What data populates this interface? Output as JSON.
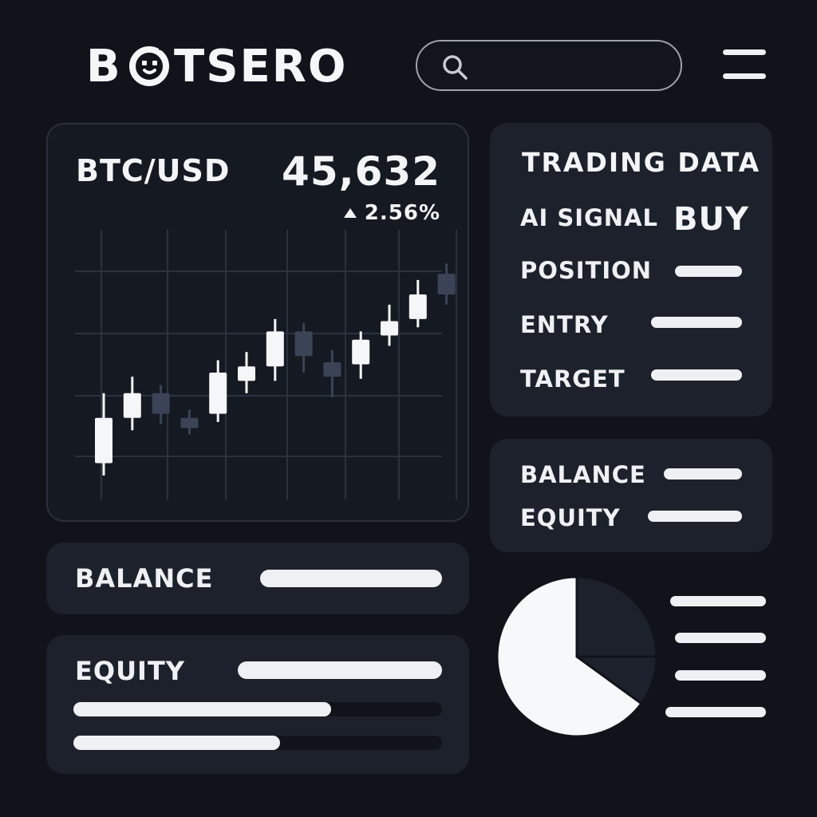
{
  "header": {
    "logo_text": "BOTSERO",
    "search": {
      "placeholder": ""
    }
  },
  "market": {
    "pair": "BTC/USD",
    "price": "45,632",
    "change": "2.56%",
    "change_direction": "up",
    "candles": [
      {
        "open": 0.28,
        "close": 0.5,
        "high": 0.62,
        "low": 0.22,
        "bullish": true
      },
      {
        "open": 0.5,
        "close": 0.62,
        "high": 0.7,
        "low": 0.44,
        "bullish": true
      },
      {
        "open": 0.62,
        "close": 0.52,
        "high": 0.66,
        "low": 0.47,
        "bullish": false
      },
      {
        "open": 0.5,
        "close": 0.45,
        "high": 0.54,
        "low": 0.42,
        "bullish": false
      },
      {
        "open": 0.52,
        "close": 0.72,
        "high": 0.78,
        "low": 0.48,
        "bullish": true
      },
      {
        "open": 0.68,
        "close": 0.75,
        "high": 0.82,
        "low": 0.62,
        "bullish": true
      },
      {
        "open": 0.75,
        "close": 0.92,
        "high": 0.98,
        "low": 0.68,
        "bullish": true
      },
      {
        "open": 0.92,
        "close": 0.8,
        "high": 0.96,
        "low": 0.72,
        "bullish": false
      },
      {
        "open": 0.77,
        "close": 0.7,
        "high": 0.83,
        "low": 0.6,
        "bullish": false
      },
      {
        "open": 0.76,
        "close": 0.88,
        "high": 0.92,
        "low": 0.69,
        "bullish": true
      },
      {
        "open": 0.9,
        "close": 0.97,
        "high": 1.05,
        "low": 0.85,
        "bullish": true
      },
      {
        "open": 0.98,
        "close": 1.1,
        "high": 1.17,
        "low": 0.94,
        "bullish": true
      },
      {
        "open": 1.1,
        "close": 1.2,
        "high": 1.25,
        "low": 1.05,
        "bullish": false
      }
    ]
  },
  "trading": {
    "title": "TRADING DATA",
    "ai_signal_label": "AI SIGNAL",
    "ai_signal_value": "BUY",
    "position_label": "POSITION",
    "entry_label": "ENTRY",
    "target_label": "TARGET"
  },
  "account": {
    "balance_label": "BALANCE",
    "equity_label": "EQUITY"
  },
  "summary": {
    "balance_label": "BALANCE",
    "equity_label": "EQUITY",
    "progress": [
      0.7,
      0.56
    ]
  },
  "allocation": {
    "slices": [
      0.25,
      0.1,
      0.65
    ]
  },
  "colors": {
    "background": "#10131a",
    "panel": "#1c212c",
    "text": "#eef0f3",
    "candle_up": "#f5f6f8",
    "candle_down": "#3b4456"
  }
}
